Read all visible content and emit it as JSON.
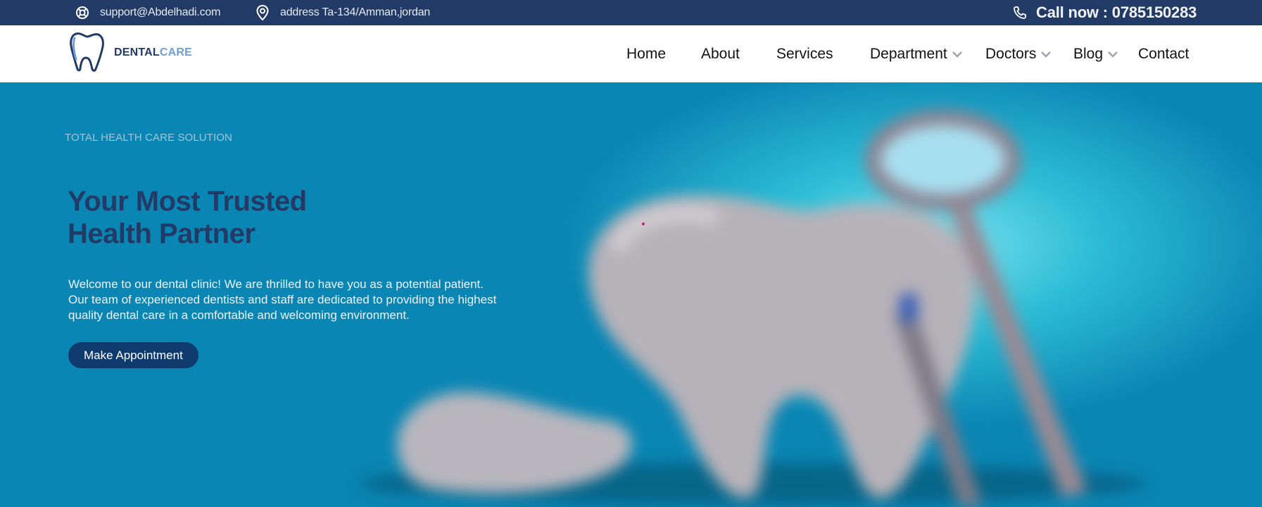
{
  "topbar": {
    "email": "support@Abdelhadi.com",
    "address": "address Ta-134/Amman,jordan",
    "call": "Call now : 0785150283",
    "icons": {
      "email": "lifebuoy-icon",
      "address": "location-pin-icon",
      "call": "phone-icon"
    }
  },
  "brand": {
    "part1": "DENTAL",
    "part2": "CARE",
    "logo_icon": "tooth-icon"
  },
  "nav": {
    "home": "Home",
    "about": "About",
    "services": "Services",
    "department": "Department",
    "doctors": "Doctors",
    "blog": "Blog",
    "contact": "Contact"
  },
  "hero": {
    "eyebrow": "TOTAL HEALTH CARE SOLUTION",
    "headline_line1": "Your Most Trusted",
    "headline_line2": "Health Partner",
    "desc_line1": "Welcome to our dental clinic! We are thrilled to have you as a potential patient.",
    "desc_line2": "Our team of experienced dentists and staff are dedicated to providing the highest",
    "desc_line3": "quality dental care in a comfortable and welcoming environment.",
    "cta": "Make Appointment"
  },
  "colors": {
    "topbar_bg": "#223a66",
    "hero_bg": "#0a86b4",
    "headline": "#223a66",
    "cta_bg": "#0e3a6e",
    "brand_accent": "#6f9ed6"
  }
}
